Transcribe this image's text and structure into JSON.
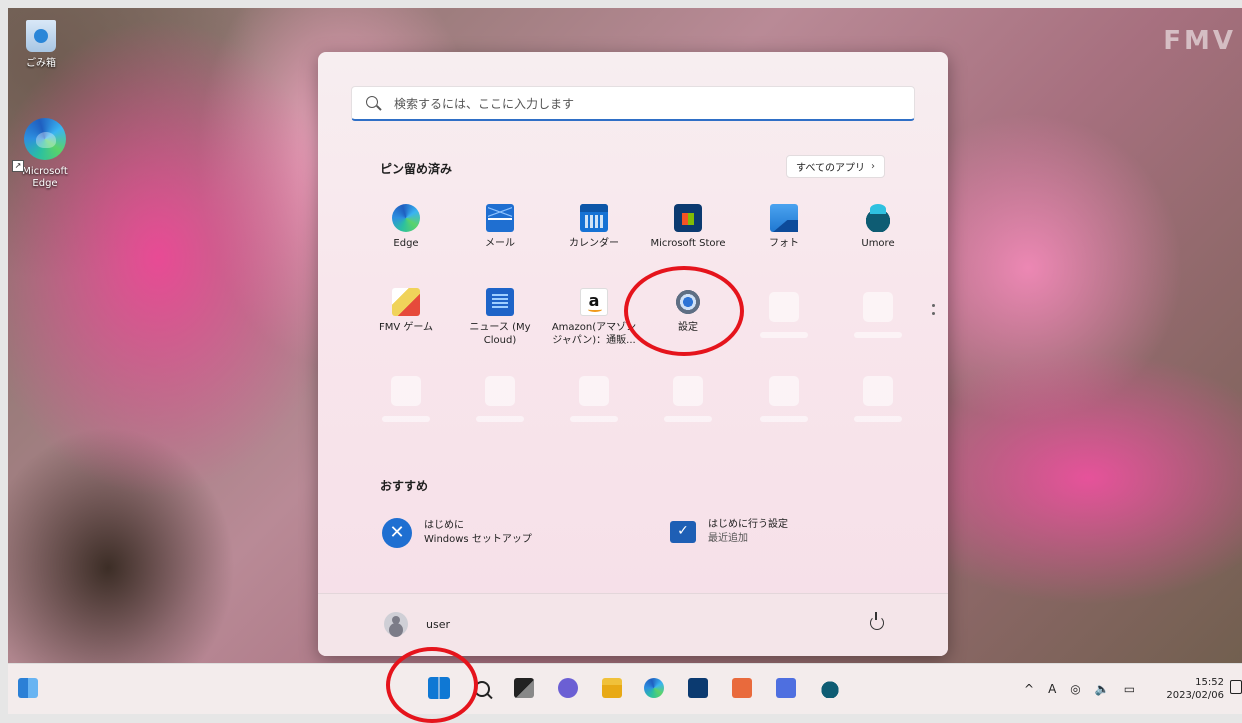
{
  "desktop": {
    "icons": [
      {
        "label": "ごみ箱"
      },
      {
        "label_line1": "Microsoft",
        "label_line2": "Edge"
      }
    ],
    "watermark": "FMV"
  },
  "start_menu": {
    "search_placeholder": "検索するには、ここに入力します",
    "pinned_title": "ピン留め済み",
    "all_apps_label": "すべてのアプリ",
    "pinned_apps": [
      {
        "label": "Edge",
        "icon": "edge-icon"
      },
      {
        "label": "メール",
        "icon": "mail-icon"
      },
      {
        "label": "カレンダー",
        "icon": "calendar-icon"
      },
      {
        "label": "Microsoft Store",
        "icon": "store-icon"
      },
      {
        "label": "フォト",
        "icon": "photos-icon"
      },
      {
        "label": "Umore",
        "icon": "umore-icon"
      },
      {
        "label": "FMV ゲーム",
        "icon": "game-icon"
      },
      {
        "label_line1": "ニュース (My",
        "label_line2": "Cloud)",
        "icon": "news-icon"
      },
      {
        "label_line1": "Amazon(アマゾン",
        "label_line2": "ジャパン)：通販...",
        "icon": "amazon-icon"
      },
      {
        "label": "設定",
        "icon": "gear-icon"
      }
    ],
    "recommended_title": "おすすめ",
    "recommended": [
      {
        "title": "はじめに",
        "subtitle": "Windows セットアップ",
        "icon": "get-started-icon"
      },
      {
        "title": "はじめに行う設定",
        "subtitle": "最近追加",
        "icon": "setup-icon"
      }
    ],
    "user_name": "user"
  },
  "taskbar": {
    "tray_items": [
      "^",
      "A"
    ],
    "time": "15:52",
    "date": "2023/02/06"
  },
  "colors": {
    "accent": "#2f6fc6",
    "highlight_circle": "#e5141c"
  }
}
